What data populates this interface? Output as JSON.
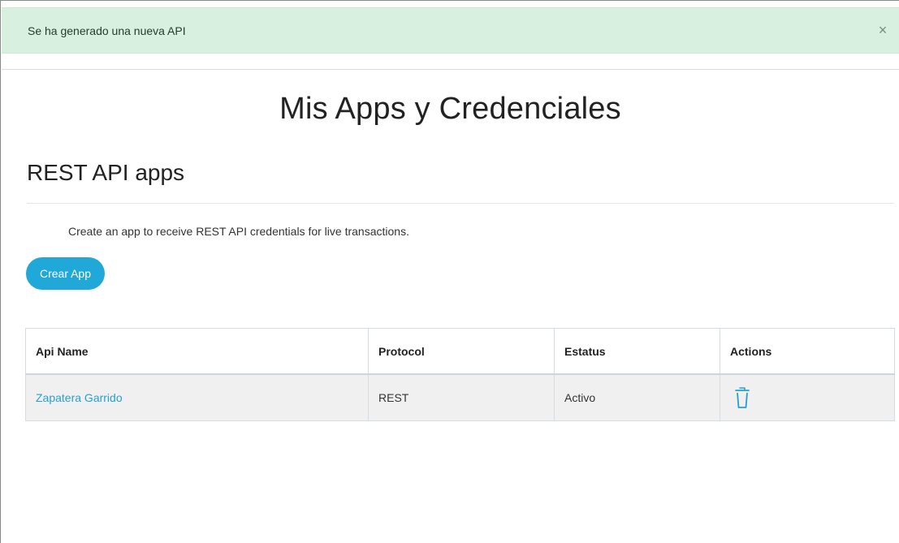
{
  "alert": {
    "message": "Se ha generado una nueva API",
    "close_label": "×"
  },
  "page": {
    "title": "Mis Apps y Credenciales"
  },
  "section": {
    "title": "REST API apps",
    "description": "Create an app to receive REST API credentials for live transactions.",
    "create_button_label": "Crear App"
  },
  "table": {
    "headers": [
      "Api Name",
      "Protocol",
      "Estatus",
      "Actions"
    ],
    "rows": [
      {
        "name": "Zapatera Garrido",
        "protocol": "REST",
        "status": "Activo",
        "action_icon": "trash-icon"
      }
    ]
  },
  "colors": {
    "alert_bg": "#d8f0df",
    "accent": "#1fa8d8",
    "link": "#27a0d0"
  }
}
